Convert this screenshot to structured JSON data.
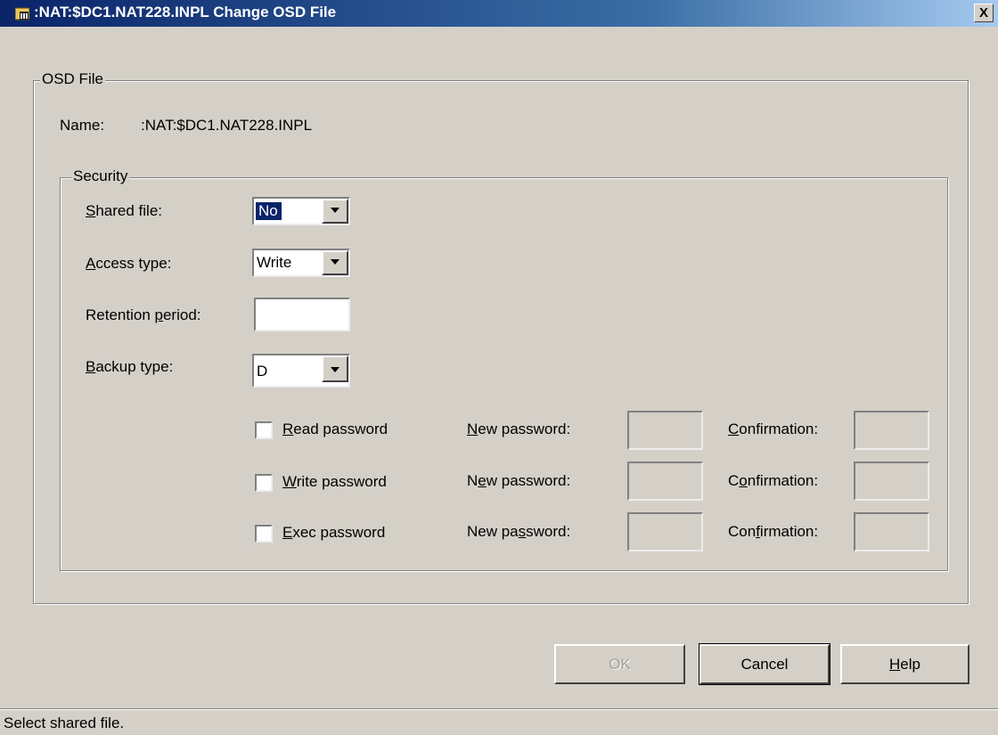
{
  "window": {
    "title": ":NAT:$DC1.NAT228.INPL Change OSD File",
    "close_label": "X"
  },
  "osd_group": {
    "legend": "OSD File",
    "name_label": "Name:",
    "name_value": ":NAT:$DC1.NAT228.INPL"
  },
  "security": {
    "legend": "Security",
    "shared_file": {
      "pre": "",
      "ul": "S",
      "post": "hared file:",
      "value": "No"
    },
    "access_type": {
      "pre": "",
      "ul": "A",
      "post": "ccess type:",
      "value": "Write"
    },
    "retention_period": {
      "pre": "Retention ",
      "ul": "p",
      "post": "eriod:",
      "value": ""
    },
    "backup_type": {
      "pre": "",
      "ul": "B",
      "post": "ackup type:",
      "value": "D"
    }
  },
  "passwords": [
    {
      "checkbox": {
        "pre": "",
        "ul": "R",
        "post": "ead password"
      },
      "new_label": {
        "pre": "",
        "ul": "N",
        "post": "ew password:"
      },
      "confirm_label": {
        "pre": "",
        "ul": "C",
        "post": "onfirmation:"
      }
    },
    {
      "checkbox": {
        "pre": "",
        "ul": "W",
        "post": "rite password"
      },
      "new_label": {
        "pre": "N",
        "ul": "e",
        "post": "w password:"
      },
      "confirm_label": {
        "pre": "C",
        "ul": "o",
        "post": "nfirmation:"
      }
    },
    {
      "checkbox": {
        "pre": "",
        "ul": "E",
        "post": "xec password"
      },
      "new_label": {
        "pre": "New pa",
        "ul": "s",
        "post": "sword:"
      },
      "confirm_label": {
        "pre": "Con",
        "ul": "f",
        "post": "irmation:"
      }
    }
  ],
  "buttons": {
    "ok": "OK",
    "cancel": "Cancel",
    "help": {
      "pre": "",
      "ul": "H",
      "post": "elp"
    }
  },
  "status": "Select shared file.",
  "colors": {
    "titlebar_start": "#0a246a",
    "titlebar_end": "#a6caf0",
    "face": "#d4d0c8"
  },
  "icons": {
    "app": "folder-app-icon",
    "dropdown": "triangle-down"
  }
}
